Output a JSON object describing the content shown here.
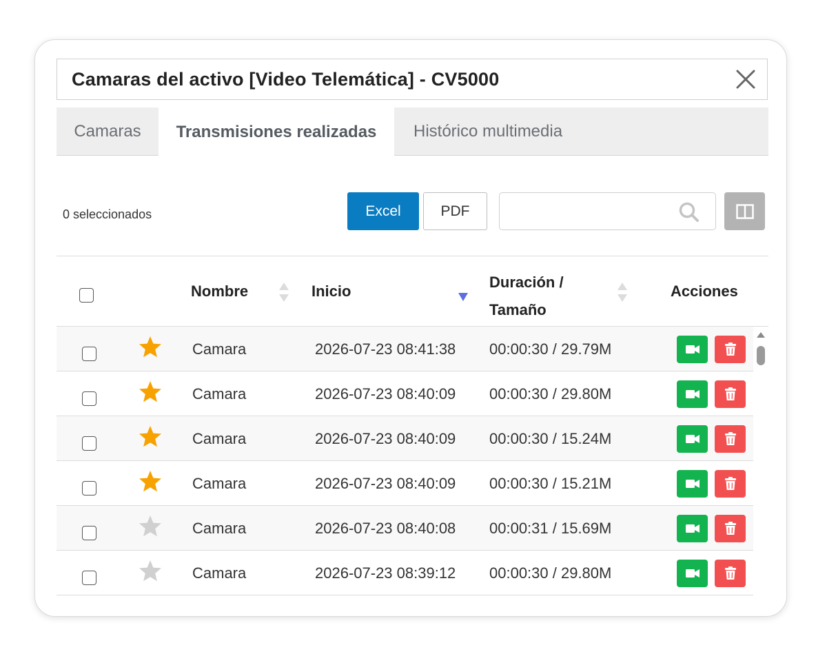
{
  "dialog": {
    "title": "Camaras del activo [Video Telemática] - CV5000"
  },
  "tabs": [
    {
      "label": "Camaras",
      "active": false
    },
    {
      "label": "Transmisiones realizadas",
      "active": true
    },
    {
      "label": "Histórico multimedia",
      "active": false
    }
  ],
  "toolbar": {
    "selected_count": "0 seleccionados",
    "excel_label": "Excel",
    "pdf_label": "PDF",
    "search_value": "",
    "search_icon": "search-icon",
    "columns_icon": "columns-icon"
  },
  "table": {
    "headers": {
      "nombre": "Nombre",
      "inicio": "Inicio",
      "duracion_line1": "Duración /",
      "duracion_line2": "Tamaño",
      "acciones": "Acciones"
    },
    "sort": {
      "column": "Inicio",
      "direction": "descending"
    },
    "rows": [
      {
        "starred": true,
        "nombre": "Camara",
        "inicio": "2026-07-23 08:41:38",
        "duracion": "00:00:30 / 29.79M"
      },
      {
        "starred": true,
        "nombre": "Camara",
        "inicio": "2026-07-23 08:40:09",
        "duracion": "00:00:30 / 29.80M"
      },
      {
        "starred": true,
        "nombre": "Camara",
        "inicio": "2026-07-23 08:40:09",
        "duracion": "00:00:30 / 15.24M"
      },
      {
        "starred": true,
        "nombre": "Camara",
        "inicio": "2026-07-23 08:40:09",
        "duracion": "00:00:30 / 15.21M"
      },
      {
        "starred": false,
        "nombre": "Camara",
        "inicio": "2026-07-23 08:40:08",
        "duracion": "00:00:31 / 15.69M"
      },
      {
        "starred": false,
        "nombre": "Camara",
        "inicio": "2026-07-23 08:39:12",
        "duracion": "00:00:30 / 29.80M"
      }
    ]
  },
  "colors": {
    "excel": "#0a7cc1",
    "video_action": "#13b34f",
    "delete_action": "#f25050",
    "star_on": "#f7a200",
    "star_off": "#d0d0d0",
    "sort_active": "#5b6fe0"
  }
}
